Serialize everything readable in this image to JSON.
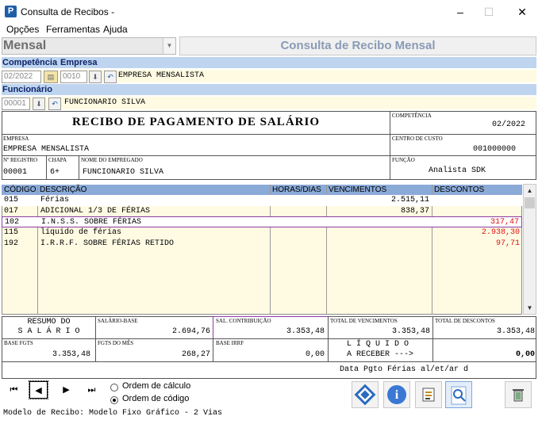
{
  "window": {
    "title": "Consulta de Recibos -",
    "app_icon": "P",
    "minimize_glyph": "–",
    "maximize_glyph": "☐",
    "close_glyph": "✕"
  },
  "menu": [
    "Opções",
    "Ferramentas",
    "Ajuda"
  ],
  "header": {
    "mode_value": "Mensal",
    "banner": "Consulta de Recibo Mensal"
  },
  "filters": {
    "competencia_label": "Competência",
    "empresa_label": "Empresa",
    "competencia_value": "02/2022",
    "empresa_code": "0010",
    "empresa_name": "EMPRESA MENSALISTA",
    "funcionario_label": "Funcionário",
    "funcionario_code": "00001",
    "funcionario_name": "FUNCIONARIO SILVA"
  },
  "receipt": {
    "title": "RECIBO DE PAGAMENTO DE SALÁRIO",
    "competencia_label": "COMPETÊNCIA",
    "competencia_value": "02/2022",
    "empresa_label": "EMPRESA",
    "empresa_value": "EMPRESA MENSALISTA",
    "centro_label": "CENTRO DE CUSTO",
    "centro_value": "001000000",
    "registro_label": "Nº REGISTRO",
    "registro_value": "00001",
    "chapa_label": "CHAPA",
    "chapa_value": "6+",
    "nome_label": "NOME DO EMPREGADO",
    "nome_value": "FUNCIONARIO SILVA",
    "funcao_label": "FUNÇÃO",
    "funcao_value": "Analista SDK"
  },
  "table": {
    "headers": [
      "CÓDIGO",
      "DESCRIÇÃO",
      "HORAS/DIAS",
      "VENCIMENTOS",
      "DESCONTOS"
    ],
    "rows": [
      {
        "codigo": "015",
        "descricao": "Férias",
        "horas": "",
        "vencimentos": "2.515,11",
        "descontos": ""
      },
      {
        "codigo": "017",
        "descricao": "ADICIONAL 1/3 DE FÉRIAS",
        "horas": "",
        "vencimentos": "838,37",
        "descontos": ""
      },
      {
        "codigo": "102",
        "descricao": "I.N.S.S. SOBRE FÉRIAS",
        "horas": "",
        "vencimentos": "",
        "descontos": "317,47"
      },
      {
        "codigo": "115",
        "descricao": "líquido de férias",
        "horas": "",
        "vencimentos": "",
        "descontos": "2.938,30"
      },
      {
        "codigo": "192",
        "descricao": "I.R.R.F. SOBRE FÉRIAS RETIDO",
        "horas": "",
        "vencimentos": "",
        "descontos": "97,71"
      }
    ],
    "discount_color": "#e01010"
  },
  "summary": {
    "resumo_line1": "RESUMO DO",
    "resumo_line2": "S A L Á R I O",
    "salario_base_label": "SALÁRIO-BASE",
    "salario_base_value": "2.694,76",
    "sal_contrib_label": "SAL. CONTRIBUIÇÃO",
    "sal_contrib_value": "3.353,48",
    "total_venc_label": "TOTAL DE VENCIMENTOS",
    "total_venc_value": "3.353,48",
    "total_desc_label": "TOTAL DE DESCONTOS",
    "total_desc_value": "3.353,48",
    "base_fgts_label": "BASE FGTS",
    "base_fgts_value": "3.353,48",
    "fgts_mes_label": "FGTS DO MÊS",
    "fgts_mes_value": "268,27",
    "base_irrf_label": "BASE IRRF",
    "base_irrf_value": "0,00",
    "liquido_line1": "L Í Q U I D O",
    "liquido_line2": "A RECEBER --->",
    "liquido_value": "0,00",
    "data_pgto": "Data Pgto Férias al/et/ar d"
  },
  "nav": {
    "first": "⏮",
    "prev": "◀",
    "next": "▶",
    "last": "⏭",
    "ordem_calculo": "Ordem de cálculo",
    "ordem_codigo": "Ordem de código",
    "selected_order": "Ordem de código"
  },
  "status": "Modelo de Recibo: Modelo Fixo Gráfico - 2 Vias"
}
